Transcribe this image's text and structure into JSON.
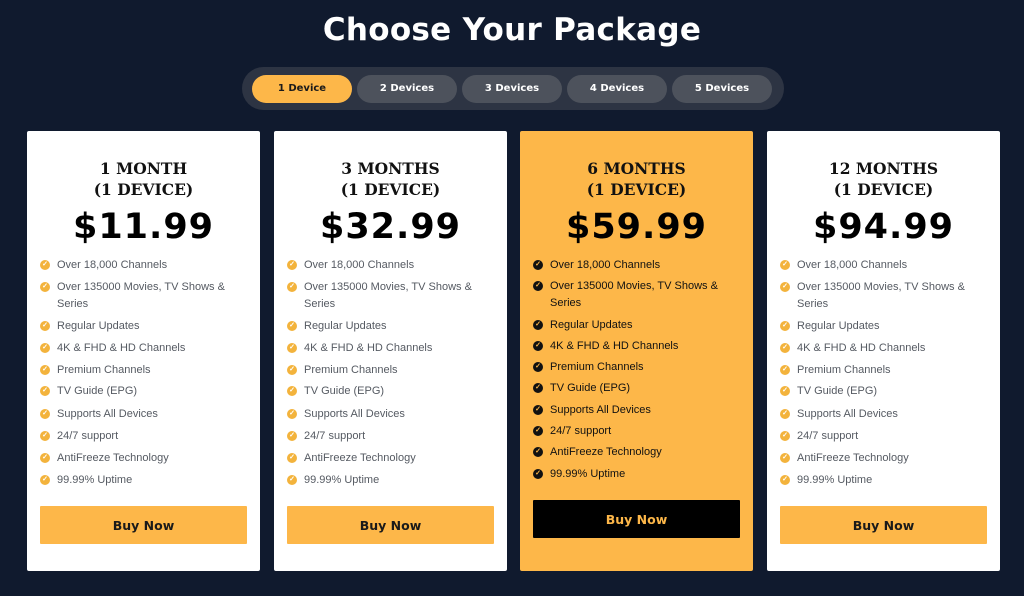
{
  "header": {
    "title": "Choose Your Package"
  },
  "tabs": [
    {
      "label": "1 Device",
      "active": true
    },
    {
      "label": "2 Devices",
      "active": false
    },
    {
      "label": "3 Devices",
      "active": false
    },
    {
      "label": "4 Devices",
      "active": false
    },
    {
      "label": "5 Devices",
      "active": false
    }
  ],
  "colors": {
    "accent": "#fdb749",
    "background": "#101a2e",
    "card": "#ffffff"
  },
  "plans": [
    {
      "title_line1": "1 MONTH",
      "title_line2": "(1 DEVICE)",
      "price": "$11.99",
      "featured": false,
      "features": [
        "Over 18,000 Channels",
        "Over 135000 Movies, TV Shows & Series",
        "Regular Updates",
        "4K & FHD & HD Channels",
        "Premium Channels",
        "TV Guide (EPG)",
        "Supports All Devices",
        "24/7 support",
        "AntiFreeze Technology",
        "99.99% Uptime"
      ],
      "button": "Buy Now"
    },
    {
      "title_line1": "3 MONTHS",
      "title_line2": "(1 DEVICE)",
      "price": "$32.99",
      "featured": false,
      "features": [
        "Over 18,000 Channels",
        "Over 135000 Movies, TV Shows & Series",
        "Regular Updates",
        "4K & FHD & HD Channels",
        "Premium Channels",
        "TV Guide (EPG)",
        "Supports All Devices",
        "24/7 support",
        "AntiFreeze Technology",
        "99.99% Uptime"
      ],
      "button": "Buy Now"
    },
    {
      "title_line1": "6 MONTHS",
      "title_line2": "(1 DEVICE)",
      "price": "$59.99",
      "featured": true,
      "features": [
        "Over 18,000 Channels",
        "Over 135000 Movies, TV Shows & Series",
        "Regular Updates",
        "4K & FHD & HD Channels",
        "Premium Channels",
        "TV Guide (EPG)",
        "Supports All Devices",
        "24/7 support",
        "AntiFreeze Technology",
        "99.99% Uptime"
      ],
      "button": "Buy Now"
    },
    {
      "title_line1": "12 MONTHS",
      "title_line2": "(1 DEVICE)",
      "price": "$94.99",
      "featured": false,
      "features": [
        "Over 18,000 Channels",
        "Over 135000 Movies, TV Shows & Series",
        "Regular Updates",
        "4K & FHD & HD Channels",
        "Premium Channels",
        "TV Guide (EPG)",
        "Supports All Devices",
        "24/7 support",
        "AntiFreeze Technology",
        "99.99% Uptime"
      ],
      "button": "Buy Now"
    }
  ]
}
